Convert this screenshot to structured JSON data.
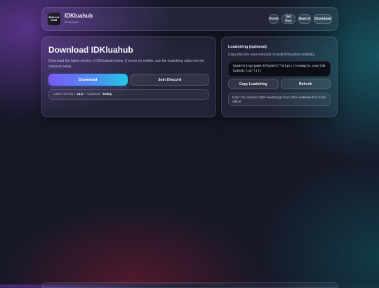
{
  "header": {
    "logo_text": "IDKLUA HUB",
    "title": "IDKluahub",
    "subtitle": "Download",
    "nav": [
      "Home",
      "Get Key",
      "Search",
      "Download"
    ]
  },
  "main": {
    "title": "Download IDKluahub",
    "description": "Download the latest version of IDKluahub below. If you're on mobile, use the loadstring option for the cleanest setup.",
    "download_label": "Download",
    "discord_label": "Join Discord",
    "version_prefix": "Latest version:",
    "version": "v1.0",
    "separator": "•",
    "updated_prefix": "Updated:",
    "updated": "Today"
  },
  "loadstring": {
    "title": "Loadstring (optional)",
    "description": "Copy this into your executor to load IDKluahub instantly.",
    "code": "loadstring(game:HttpGet(\"https://example.com/idkluahub.lua\"))()",
    "copy_label": "Copy Loadstring",
    "refresh_label": "Refresh",
    "note": "Note: Do not trust other loadstrings from other websites this is the offical"
  },
  "colors": {
    "accent_start": "#7a5af5",
    "accent_end": "#22c7e6",
    "code_bg": "#0c0e17"
  }
}
